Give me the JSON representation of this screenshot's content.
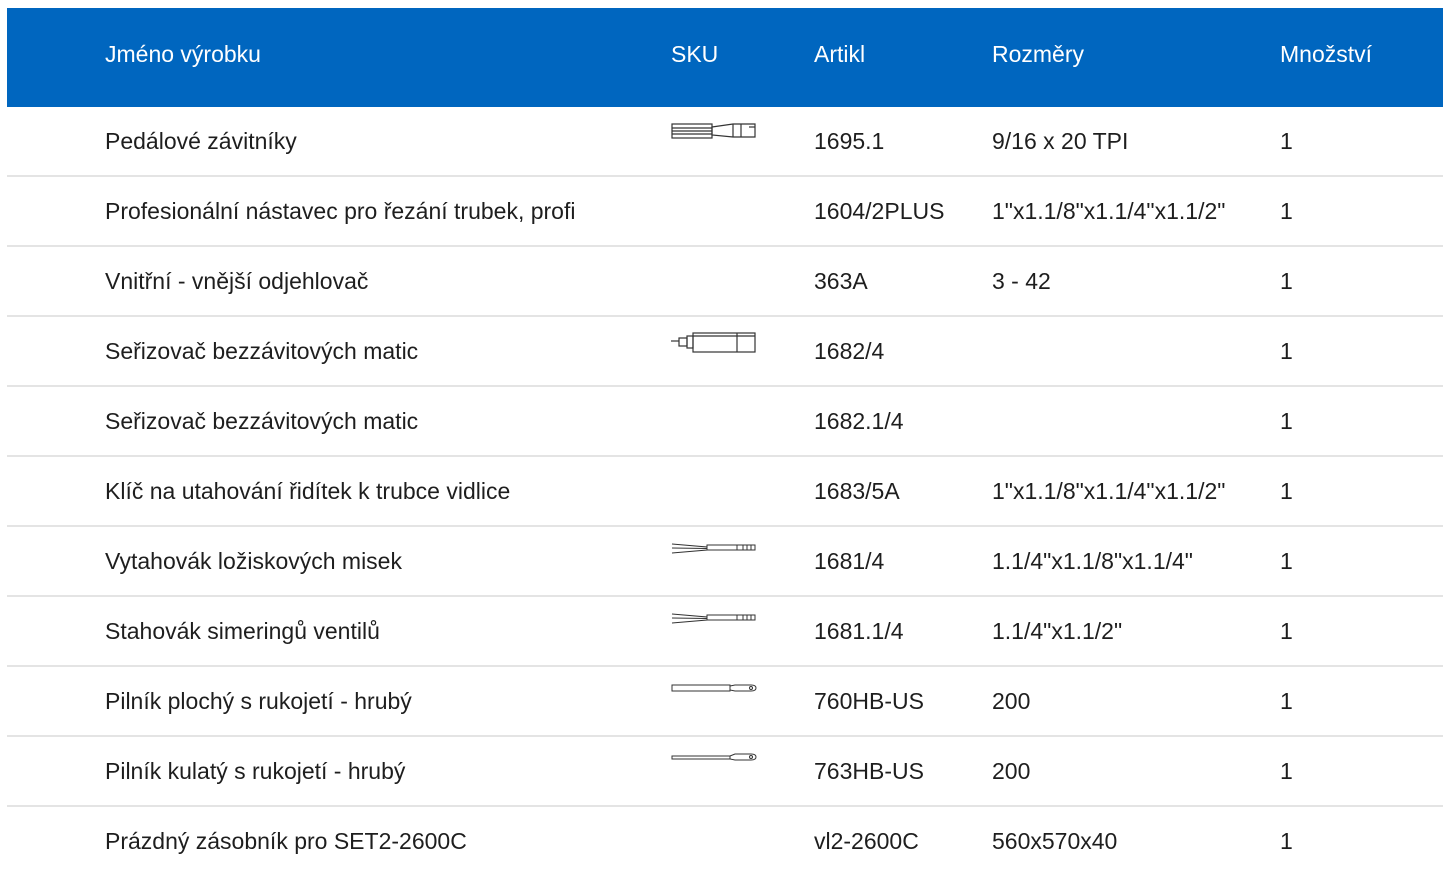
{
  "table": {
    "headers": {
      "name": "Jméno výrobku",
      "sku": "SKU",
      "article": "Artikl",
      "dimensions": "Rozměry",
      "quantity": "Množství"
    },
    "rows": [
      {
        "name": "Pedálové závitníky",
        "sku_icon": "pedal-tap-icon",
        "article": "1695.1",
        "dimensions": "9/16 x 20 TPI",
        "quantity": "1"
      },
      {
        "name": "Profesionální nástavec pro řezání trubek, profi",
        "sku_icon": "",
        "article": "1604/2PLUS",
        "dimensions": "1\"x1.1/8\"x1.1/4\"x1.1/2\"",
        "quantity": "1"
      },
      {
        "name": "Vnitřní - vnější odjehlovač",
        "sku_icon": "",
        "article": "363A",
        "dimensions": "3 - 42",
        "quantity": "1"
      },
      {
        "name": "Seřizovač bezzávitových matic",
        "sku_icon": "threadless-nut-setter-icon",
        "article": "1682/4",
        "dimensions": "",
        "quantity": "1"
      },
      {
        "name": "Seřizovač bezzávitových matic",
        "sku_icon": "",
        "article": "1682.1/4",
        "dimensions": "",
        "quantity": "1"
      },
      {
        "name": "Klíč na utahování řidítek k trubce vidlice",
        "sku_icon": "",
        "article": "1683/5A",
        "dimensions": "1\"x1.1/8\"x1.1/4\"x1.1/2\"",
        "quantity": "1"
      },
      {
        "name": "Vytahovák ložiskových misek",
        "sku_icon": "cup-remover-icon",
        "article": "1681/4",
        "dimensions": "1.1/4\"x1.1/8\"x1.1/4\"",
        "quantity": "1"
      },
      {
        "name": "Stahovák simeringů ventilů",
        "sku_icon": "cup-remover-icon",
        "article": "1681.1/4",
        "dimensions": "1.1/4\"x1.1/2\"",
        "quantity": "1"
      },
      {
        "name": "Pilník plochý s rukojetí - hrubý",
        "sku_icon": "flat-file-icon",
        "article": "760HB-US",
        "dimensions": "200",
        "quantity": "1"
      },
      {
        "name": "Pilník kulatý s rukojetí - hrubý",
        "sku_icon": "round-file-icon",
        "article": "763HB-US",
        "dimensions": "200",
        "quantity": "1"
      },
      {
        "name": "Prázdný zásobník pro SET2-2600C",
        "sku_icon": "",
        "article": "vl2-2600C",
        "dimensions": "560x570x40",
        "quantity": "1"
      }
    ]
  },
  "colors": {
    "header_bg": "#0066bf",
    "header_text": "#ffffff",
    "row_divider": "#e4e4e4"
  }
}
